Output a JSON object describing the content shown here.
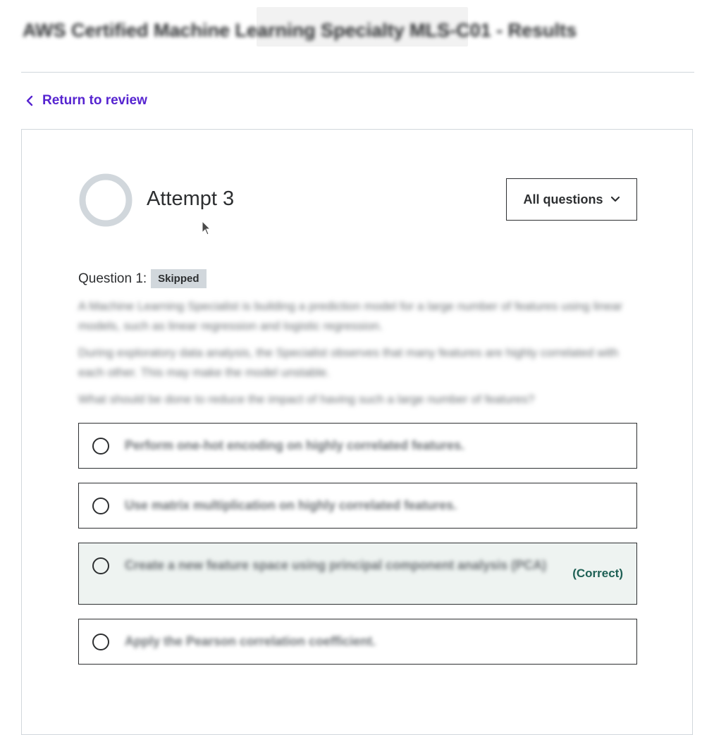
{
  "header": {
    "course_title": "AWS Certified Machine Learning Specialty MLS-C01 - Results"
  },
  "nav": {
    "return_label": "Return to review"
  },
  "attempt": {
    "title": "Attempt 3",
    "filter_label": "All questions"
  },
  "question": {
    "label": "Question 1:",
    "status": "Skipped",
    "paragraphs": [
      "A Machine Learning Specialist is building a prediction model for a large number of features using linear models, such as linear regression and logistic regression.",
      "During exploratory data analysis, the Specialist observes that many features are highly correlated with each other. This may make the model unstable.",
      "What should be done to reduce the impact of having such a large number of features?"
    ],
    "answers": [
      {
        "text": "Perform one-hot encoding on highly correlated features."
      },
      {
        "text": "Use matrix multiplication on highly correlated features."
      },
      {
        "text": "Create a new feature space using principal component analysis (PCA)",
        "tag": "(Correct)"
      },
      {
        "text": "Apply the Pearson correlation coefficient."
      }
    ]
  },
  "colors": {
    "brand_purple": "#5624d0",
    "correct_green": "#1e6055",
    "correct_bg": "#eef3f1",
    "badge_gray": "#d1d7dc",
    "ring_gray": "#d1d7dc"
  }
}
